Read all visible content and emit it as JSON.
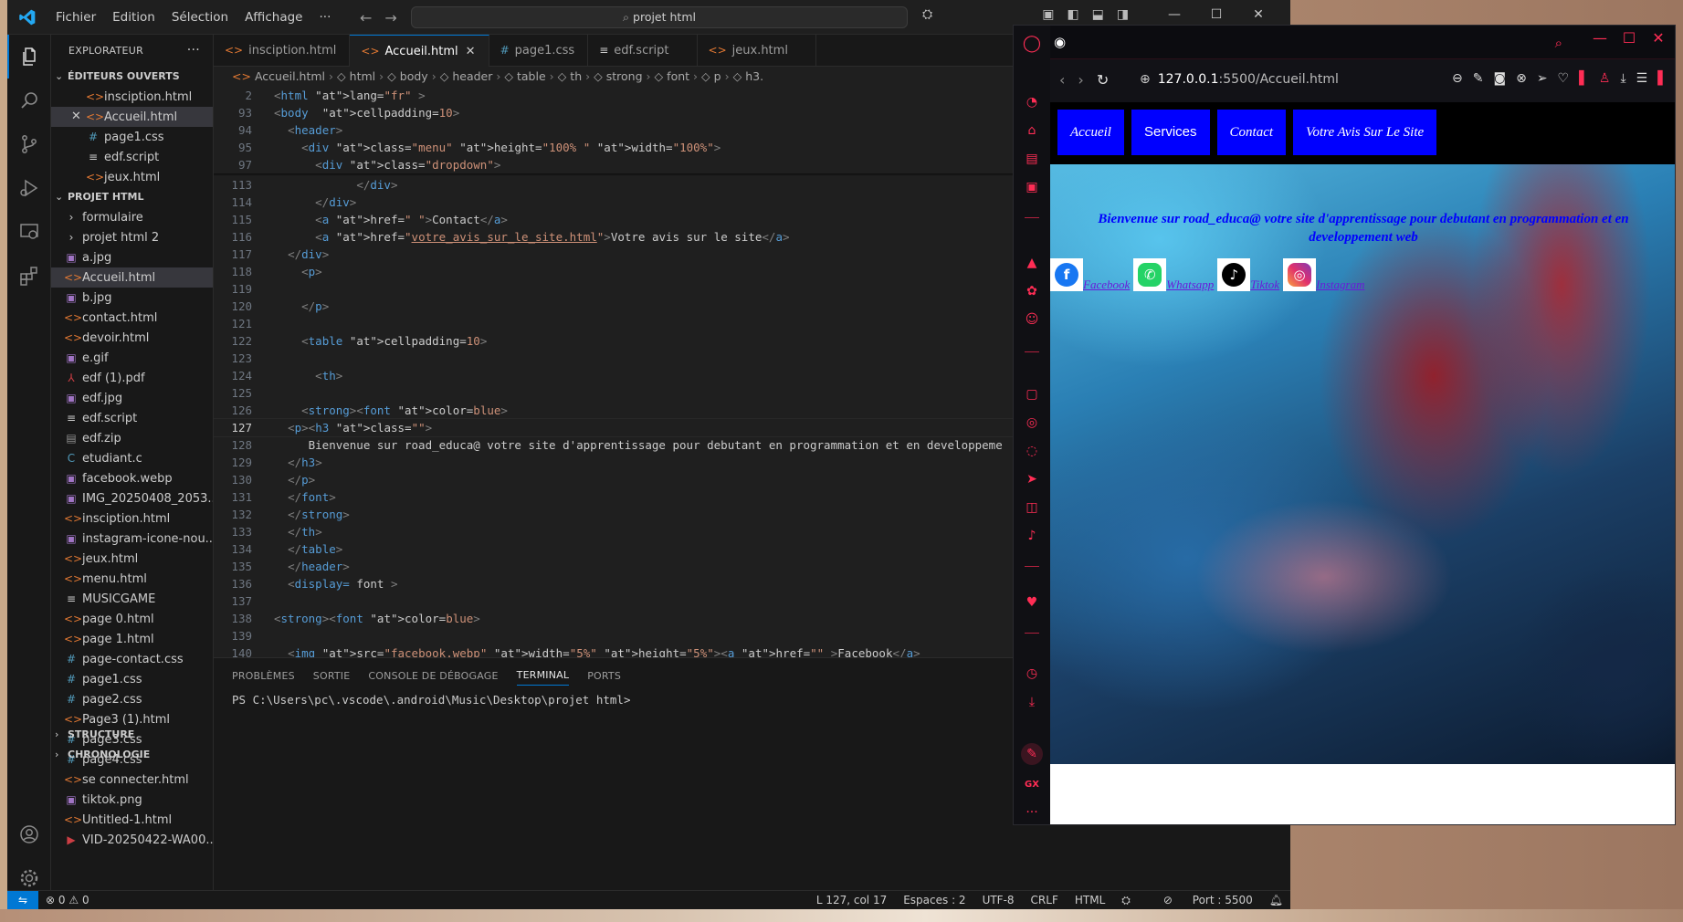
{
  "vscode": {
    "menu": [
      "Fichier",
      "Edition",
      "Sélection",
      "Affichage",
      "···"
    ],
    "command_center": "projet html",
    "tabs": [
      {
        "label": "insciption.html",
        "icon": "html-file-icon"
      },
      {
        "label": "Accueil.html",
        "icon": "html-file-icon"
      },
      {
        "label": "page1.css",
        "icon": "css-file-icon"
      },
      {
        "label": "edf.script",
        "icon": "generic-file-icon"
      },
      {
        "label": "jeux.html",
        "icon": "html-file-icon"
      }
    ],
    "breadcrumb": [
      "Accueil.html",
      "html",
      "body",
      "header",
      "table",
      "th",
      "strong",
      "font",
      "p",
      "h3."
    ],
    "explorer": {
      "title": "EXPLORATEUR",
      "open_editors_label": "ÉDITEURS OUVERTS",
      "open_editors": [
        "insciption.html",
        "Accueil.html",
        "page1.css",
        "edf.script",
        "jeux.html"
      ],
      "project_label": "PROJET HTML",
      "folders": [
        "formulaire",
        "projet html 2"
      ],
      "files": [
        "a.jpg",
        "Accueil.html",
        "b.jpg",
        "contact.html",
        "devoir.html",
        "e.gif",
        "edf (1).pdf",
        "edf.jpg",
        "edf.script",
        "edf.zip",
        "etudiant.c",
        "facebook.webp",
        "IMG_20250408_2053...",
        "insciption.html",
        "instagram-icone-nou...",
        "jeux.html",
        "menu.html",
        "MUSICGAME",
        "page 0.html",
        "page 1.html",
        "page-contact.css",
        "page1.css",
        "page2.css",
        "Page3 (1).html",
        "page3.css",
        "page4.css",
        "se connecter.html",
        "tiktok.png",
        "Untitled-1.html",
        "VID-20250422-WA00..."
      ],
      "structure_label": "STRUCTURE",
      "timeline_label": "CHRONOLOGIE"
    },
    "editor_lines": [
      {
        "n": "2",
        "code": "<html lang=\"fr\" >"
      },
      {
        "n": "93",
        "code": "<body  cellpadding=10>"
      },
      {
        "n": "94",
        "code": "  <header>"
      },
      {
        "n": "95",
        "code": "    <div class=\"menu\" height=\"100% \" width=\"100%\">"
      },
      {
        "n": "97",
        "code": "      <div class=\"dropdown\">"
      },
      {
        "n": "113",
        "code": "            </div>"
      },
      {
        "n": "114",
        "code": "      </div>"
      },
      {
        "n": "115",
        "code": "      <a href=\" \">Contact</a>"
      },
      {
        "n": "116",
        "code": "      <a href=\"votre_avis_sur_le_site.html\">Votre avis sur le site</a>"
      },
      {
        "n": "117",
        "code": "  </div>"
      },
      {
        "n": "118",
        "code": "    <p>"
      },
      {
        "n": "119",
        "code": ""
      },
      {
        "n": "120",
        "code": "    </p>"
      },
      {
        "n": "121",
        "code": ""
      },
      {
        "n": "122",
        "code": "    <table cellpadding=10>"
      },
      {
        "n": "123",
        "code": ""
      },
      {
        "n": "124",
        "code": "      <th>"
      },
      {
        "n": "125",
        "code": ""
      },
      {
        "n": "126",
        "code": "    <strong><font color=blue>"
      },
      {
        "n": "127",
        "code": "  <p><h3 class=\"\">"
      },
      {
        "n": "128",
        "code": "     Bienvenue sur road_educa@ votre site d'apprentissage pour debutant en programmation et en developpeme"
      },
      {
        "n": "129",
        "code": "  </h3>"
      },
      {
        "n": "130",
        "code": "  </p>"
      },
      {
        "n": "131",
        "code": "  </font>"
      },
      {
        "n": "132",
        "code": "  </strong>"
      },
      {
        "n": "133",
        "code": "  </th>"
      },
      {
        "n": "134",
        "code": "  </table>"
      },
      {
        "n": "135",
        "code": "  </header>"
      },
      {
        "n": "136",
        "code": "  <display= font >"
      },
      {
        "n": "137",
        "code": ""
      },
      {
        "n": "138",
        "code": "<strong><font color=blue>"
      },
      {
        "n": "139",
        "code": ""
      },
      {
        "n": "140",
        "code": "  <img src=\"facebook.webp\" width=\"5%\" height=\"5%\"><a href=\"\" >Facebook</a>"
      }
    ],
    "current_line": "127",
    "panel_tabs": [
      "PROBLÈMES",
      "SORTIE",
      "CONSOLE DE DÉBOGAGE",
      "TERMINAL",
      "PORTS"
    ],
    "active_panel_tab": "TERMINAL",
    "terminal_prompt": "PS C:\\Users\\pc\\.vscode\\.android\\Music\\Desktop\\projet html>",
    "status": {
      "problems": "0",
      "warnings": "0",
      "position": "L 127, col 17",
      "spaces": "Espaces : 2",
      "encoding": "UTF-8",
      "eol": "CRLF",
      "language": "HTML",
      "port": "Port : 5500"
    }
  },
  "browser": {
    "url_host": "127.0.0.1",
    "url_path": ":5500/Accueil.html",
    "page": {
      "nav": [
        "Accueil",
        "Services",
        "Contact",
        "Votre Avis Sur Le Site"
      ],
      "welcome": "Bienvenue sur road_educa@ votre site d'apprentissage pour debutant en programmation et en developpement web",
      "socials": [
        {
          "label": "Facebook",
          "icon": "facebook-icon",
          "color": "#1877f2"
        },
        {
          "label": "Whatsapp",
          "icon": "whatsapp-icon",
          "color": "#25d366"
        },
        {
          "label": "Tiktok",
          "icon": "tiktok-icon",
          "color": "#000000"
        },
        {
          "label": "Instagram",
          "icon": "instagram-icon",
          "color": "#e1306c"
        }
      ]
    },
    "accent": "#ff2d55"
  }
}
